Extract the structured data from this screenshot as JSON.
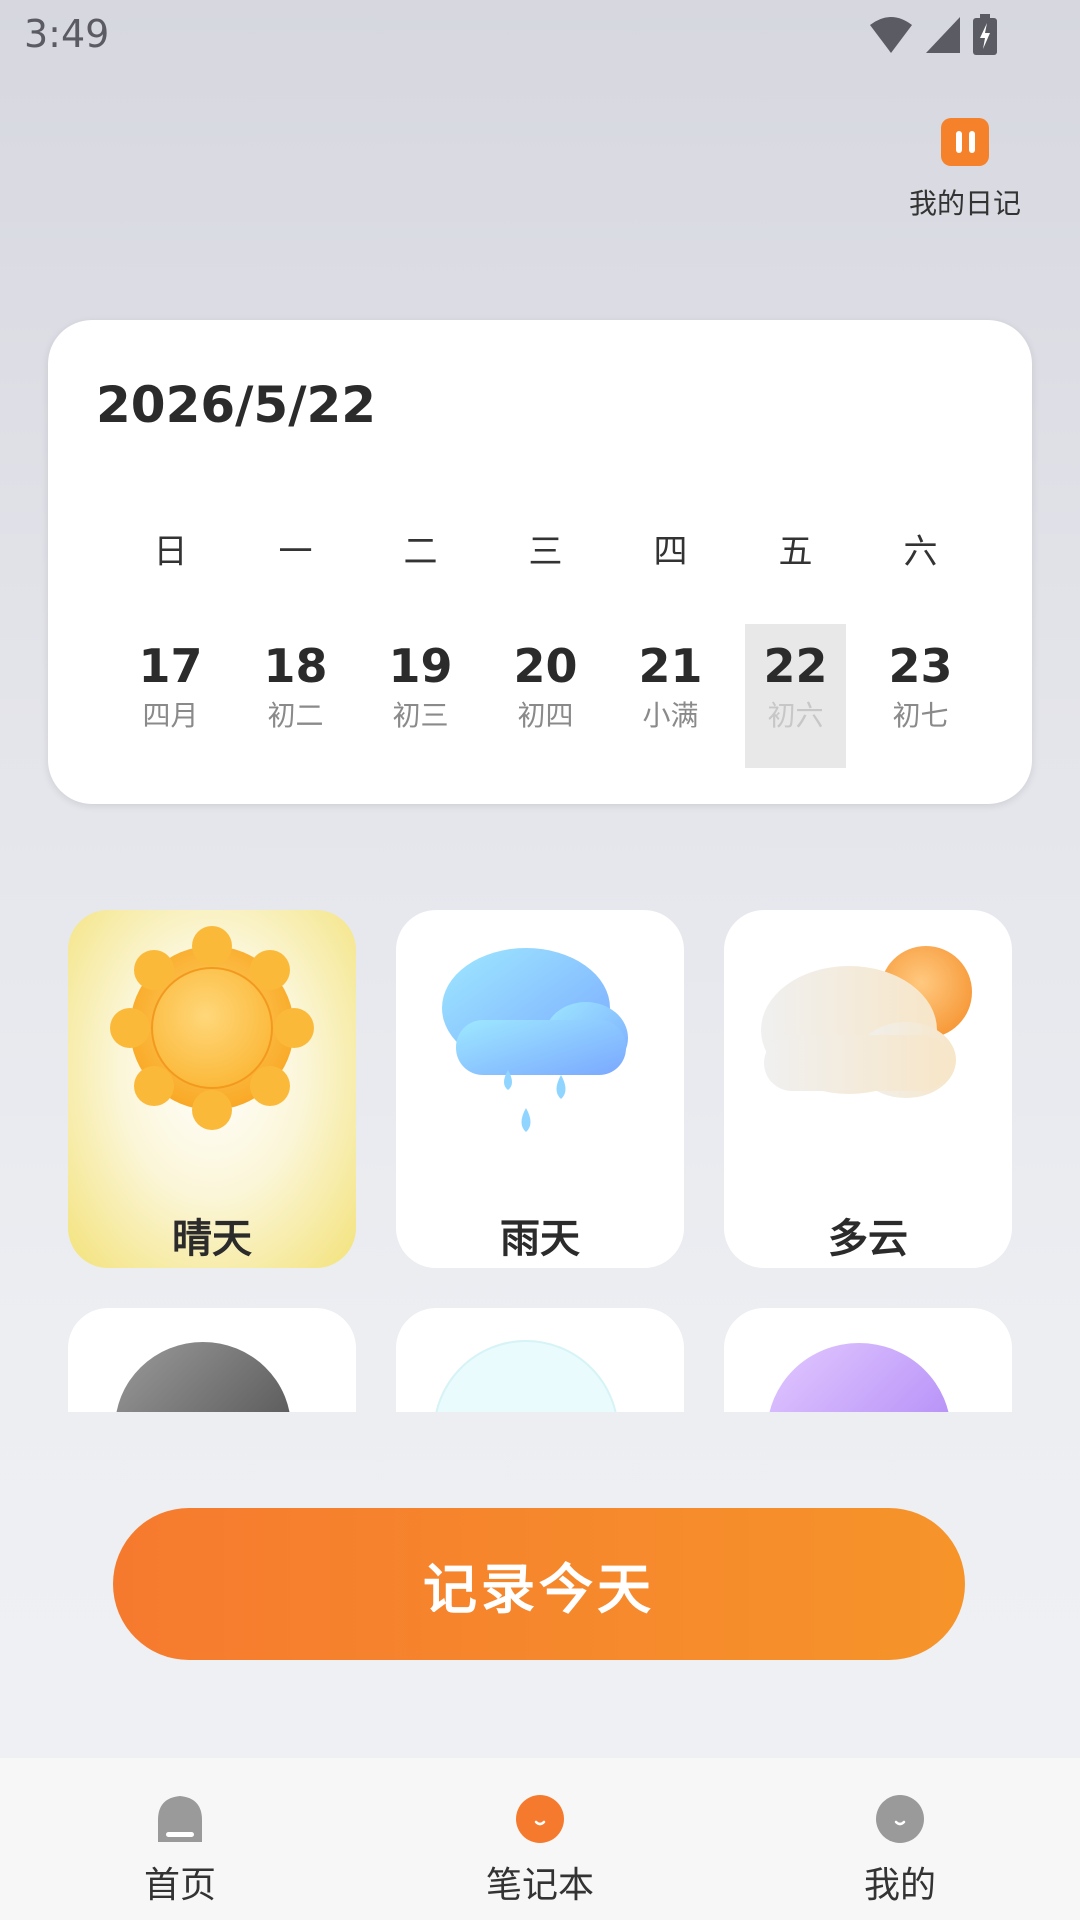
{
  "status_bar": {
    "time": "3:49"
  },
  "header": {
    "diary_label": "我的日记"
  },
  "calendar": {
    "date": "2026/5/22",
    "weekdays": [
      "日",
      "一",
      "二",
      "三",
      "四",
      "五",
      "六"
    ],
    "days": [
      {
        "num": "17",
        "lunar": "四月"
      },
      {
        "num": "18",
        "lunar": "初二"
      },
      {
        "num": "19",
        "lunar": "初三"
      },
      {
        "num": "20",
        "lunar": "初四"
      },
      {
        "num": "21",
        "lunar": "小满"
      },
      {
        "num": "22",
        "lunar": "初六"
      },
      {
        "num": "23",
        "lunar": "初七"
      }
    ]
  },
  "weather": {
    "options": [
      {
        "label": "晴天",
        "icon": "sun-icon"
      },
      {
        "label": "雨天",
        "icon": "rain-cloud-icon"
      },
      {
        "label": "多云",
        "icon": "cloudy-icon"
      },
      {
        "label": "",
        "icon": "dark-cloud-icon"
      },
      {
        "label": "",
        "icon": "snow-cloud-icon"
      },
      {
        "label": "",
        "icon": "purple-cloud-icon"
      }
    ]
  },
  "actions": {
    "record_label": "记录今天"
  },
  "bottom_nav": {
    "items": [
      {
        "label": "首页"
      },
      {
        "label": "笔记本"
      },
      {
        "label": "我的"
      }
    ]
  },
  "colors": {
    "accent": "#f67a2e",
    "selected_day_bg": "#e8e8e8",
    "sunny_card": "#f3e27a"
  }
}
